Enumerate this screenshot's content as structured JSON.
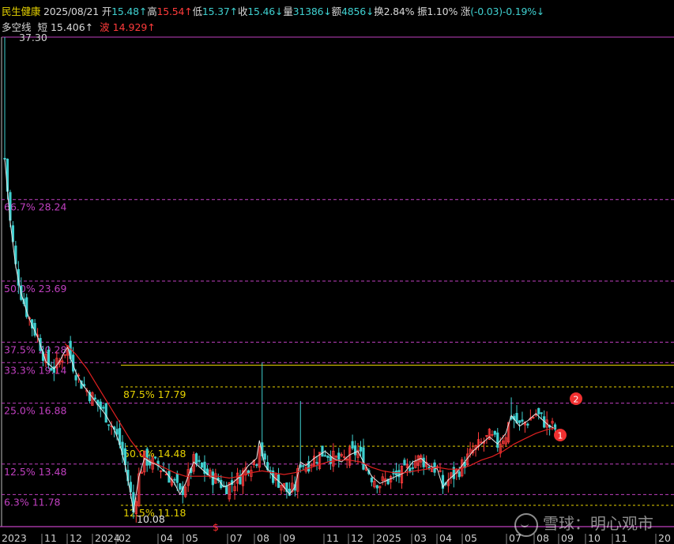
{
  "header": {
    "name": "民生健康",
    "date": "2025/08/21",
    "open_label": "开",
    "open": "15.48↑",
    "high_label": "高",
    "high": "15.54↑",
    "low_label": "低",
    "low": "15.37↑",
    "close_label": "收",
    "close": "15.46↓",
    "vol_label": "量",
    "vol": "31386↓",
    "amt_label": "额",
    "amt": "4856↓",
    "turn_label": "换",
    "turn": "2.84%",
    "amp_label": "振",
    "amp": "1.10%",
    "chg_label": "涨",
    "chg": "(-0.03)-0.19%↓"
  },
  "indicator": {
    "name": "多空线",
    "short_label": "短",
    "short_value": "15.406↑",
    "wave_label": "波",
    "wave_value": "14.929↑"
  },
  "watermark": {
    "text": "雪球：明心观市"
  },
  "colors": {
    "up": "#ff3b3b",
    "down": "#3fd0d0",
    "magenta": "#c040c0",
    "yellow": "#e6d200",
    "ma": "#e02020"
  },
  "chart_data": {
    "type": "candlestick",
    "y_top_label": "37.30",
    "y_low_label": "10.08",
    "ylim": [
      10.08,
      37.3
    ],
    "fib_levels": [
      {
        "label": "66.7% 28.24",
        "value": 28.24
      },
      {
        "label": "50.0% 23.69",
        "value": 23.69
      },
      {
        "label": "37.5% 20.28",
        "value": 20.28
      },
      {
        "label": "33.3% 19.14",
        "value": 19.14
      },
      {
        "label": "25.0% 16.88",
        "value": 16.88
      },
      {
        "label": "12.5% 13.48",
        "value": 13.48
      },
      {
        "label": "6.3% 11.78",
        "value": 11.78
      }
    ],
    "sub_levels": [
      {
        "label": "87.5% 17.79",
        "value": 17.79
      },
      {
        "label": "50.0% 14.48",
        "value": 14.48
      },
      {
        "label": "12.5% 11.18",
        "value": 11.18
      }
    ],
    "sub_top_value": 19.0,
    "x_labels": [
      "2023",
      "11",
      "12",
      "2024",
      "02",
      "04",
      "05",
      "07",
      "08",
      "09",
      "11",
      "12",
      "2025",
      "03",
      "04",
      "05",
      "07",
      "08",
      "09",
      "10",
      "11",
      "20"
    ],
    "markers": [
      {
        "label": "1"
      },
      {
        "label": "2"
      }
    ],
    "bottom_marker": "$",
    "close_path": [
      [
        0,
        30.5
      ],
      [
        2,
        27.0
      ],
      [
        4,
        24.5
      ],
      [
        6,
        23.0
      ],
      [
        8,
        22.0
      ],
      [
        10,
        21.2
      ],
      [
        12,
        20.6
      ],
      [
        15,
        19.2
      ],
      [
        18,
        18.8
      ],
      [
        20,
        19.2
      ],
      [
        22,
        19.8
      ],
      [
        23,
        20.0
      ],
      [
        24,
        19.4
      ],
      [
        26,
        18.6
      ],
      [
        28,
        18.0
      ],
      [
        31,
        17.4
      ],
      [
        34,
        16.8
      ],
      [
        37,
        16.2
      ],
      [
        40,
        15.4
      ],
      [
        42,
        14.6
      ],
      [
        44,
        13.4
      ],
      [
        46,
        11.8
      ],
      [
        47,
        10.8
      ],
      [
        49,
        12.8
      ],
      [
        51,
        13.8
      ],
      [
        53,
        13.6
      ],
      [
        56,
        13.4
      ],
      [
        59,
        13.0
      ],
      [
        62,
        12.4
      ],
      [
        64,
        11.8
      ],
      [
        66,
        12.4
      ],
      [
        69,
        13.6
      ],
      [
        72,
        13.2
      ],
      [
        75,
        12.8
      ],
      [
        78,
        12.6
      ],
      [
        80,
        12.2
      ],
      [
        83,
        12.4
      ],
      [
        86,
        12.8
      ],
      [
        89,
        13.4
      ],
      [
        92,
        13.8
      ],
      [
        93,
        14.8
      ],
      [
        95,
        13.4
      ],
      [
        98,
        12.8
      ],
      [
        101,
        12.4
      ],
      [
        104,
        11.8
      ],
      [
        106,
        12.2
      ],
      [
        108,
        13.6
      ],
      [
        110,
        13.4
      ],
      [
        113,
        13.8
      ],
      [
        117,
        14.2
      ],
      [
        120,
        13.8
      ],
      [
        123,
        13.6
      ],
      [
        126,
        14.0
      ],
      [
        129,
        14.2
      ],
      [
        131,
        13.6
      ],
      [
        134,
        12.8
      ],
      [
        137,
        12.4
      ],
      [
        140,
        12.6
      ],
      [
        143,
        12.8
      ],
      [
        146,
        13.0
      ],
      [
        149,
        13.6
      ],
      [
        152,
        13.8
      ],
      [
        155,
        13.4
      ],
      [
        158,
        13.2
      ],
      [
        160,
        12.2
      ],
      [
        162,
        12.6
      ],
      [
        165,
        13.0
      ],
      [
        168,
        13.6
      ],
      [
        171,
        14.2
      ],
      [
        174,
        14.6
      ],
      [
        177,
        15.0
      ],
      [
        180,
        14.6
      ],
      [
        183,
        15.2
      ],
      [
        185,
        16.2
      ],
      [
        188,
        15.6
      ],
      [
        191,
        15.9
      ],
      [
        194,
        16.3
      ],
      [
        196,
        16.0
      ],
      [
        199,
        15.6
      ],
      [
        201,
        15.46
      ]
    ],
    "ma_path": [
      [
        22,
        20.2
      ],
      [
        26,
        19.6
      ],
      [
        30,
        18.8
      ],
      [
        34,
        17.8
      ],
      [
        38,
        16.8
      ],
      [
        42,
        15.8
      ],
      [
        46,
        14.8
      ],
      [
        50,
        14.0
      ],
      [
        54,
        13.6
      ],
      [
        58,
        13.3
      ],
      [
        62,
        13.0
      ],
      [
        66,
        12.8
      ],
      [
        70,
        12.8
      ],
      [
        74,
        12.8
      ],
      [
        78,
        12.8
      ],
      [
        82,
        12.7
      ],
      [
        86,
        12.8
      ],
      [
        90,
        13.0
      ],
      [
        94,
        13.1
      ],
      [
        98,
        13.0
      ],
      [
        102,
        12.9
      ],
      [
        106,
        13.0
      ],
      [
        110,
        13.2
      ],
      [
        114,
        13.4
      ],
      [
        118,
        13.6
      ],
      [
        122,
        13.7
      ],
      [
        126,
        13.7
      ],
      [
        130,
        13.6
      ],
      [
        134,
        13.3
      ],
      [
        138,
        13.1
      ],
      [
        142,
        13.0
      ],
      [
        146,
        13.0
      ],
      [
        150,
        13.1
      ],
      [
        154,
        13.2
      ],
      [
        158,
        13.3
      ],
      [
        162,
        13.2
      ],
      [
        166,
        13.2
      ],
      [
        170,
        13.4
      ],
      [
        174,
        13.7
      ],
      [
        178,
        13.9
      ],
      [
        182,
        14.2
      ],
      [
        186,
        14.6
      ],
      [
        190,
        14.9
      ],
      [
        194,
        15.2
      ],
      [
        198,
        15.4
      ],
      [
        201,
        15.5
      ]
    ],
    "spikes": [
      {
        "i": 0,
        "high": 37.3
      },
      {
        "i": 94,
        "high": 19.14
      },
      {
        "i": 108,
        "high": 17.0
      },
      {
        "i": 185,
        "high": 17.2
      }
    ]
  }
}
